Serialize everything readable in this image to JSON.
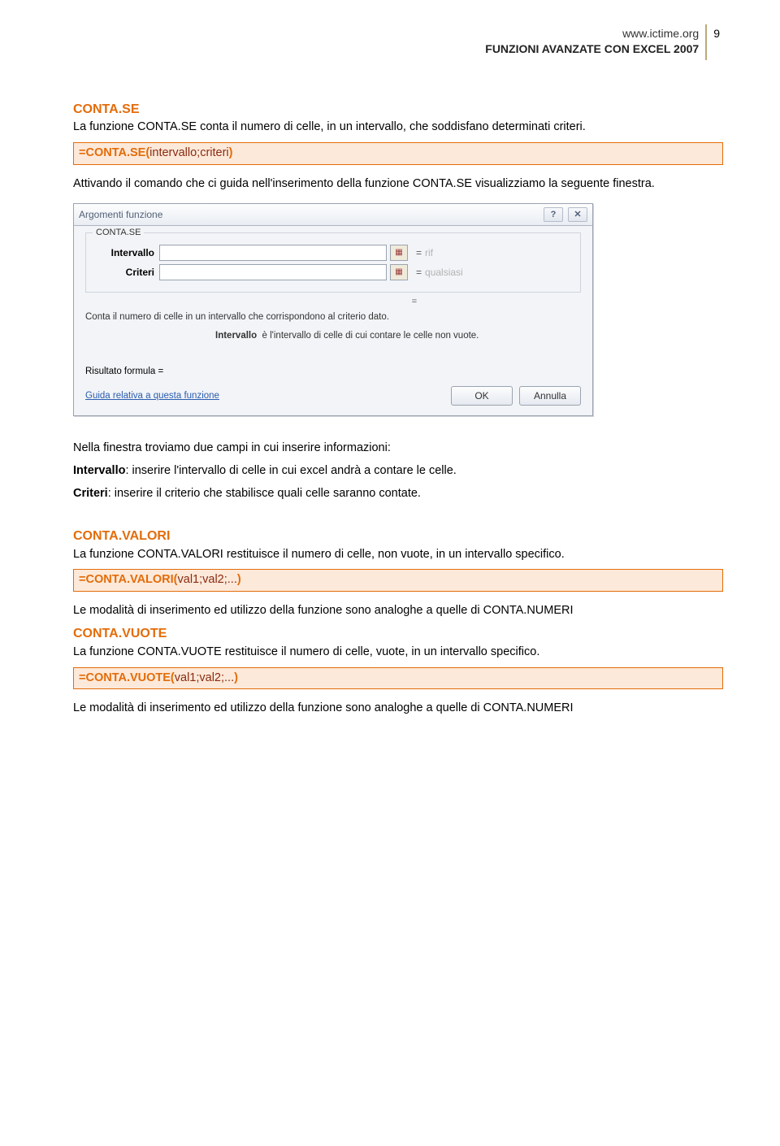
{
  "header": {
    "url": "www.ictime.org",
    "title": "FUNZIONI AVANZATE CON EXCEL 2007",
    "page": "9"
  },
  "sec1": {
    "title": "CONTA.SE",
    "intro": "La funzione CONTA.SE conta il numero di celle, in un intervallo, che soddisfano determinati criteri.",
    "formula_pre": "=CONTA.SE(",
    "formula_args": "intervallo;criteri",
    "formula_post": ")",
    "after_formula": "Attivando il comando che ci guida nell'inserimento della funzione CONTA.SE visualizziamo la seguente finestra.",
    "post_dialog_1": "Nella finestra troviamo due campi in cui inserire informazioni:",
    "post_dialog_2a": "Intervallo",
    "post_dialog_2b": ": inserire l'intervallo di celle in cui excel andrà a contare le celle.",
    "post_dialog_3a": "Criteri",
    "post_dialog_3b": ": inserire il criterio che stabilisce quali celle saranno contate."
  },
  "dialog": {
    "title": "Argomenti funzione",
    "legend": "CONTA.SE",
    "arg1_label": "Intervallo",
    "arg1_hint": "rif",
    "arg2_label": "Criteri",
    "arg2_hint": "qualsiasi",
    "eq": "=",
    "desc": "Conta il numero di celle in un intervallo che corrispondono al criterio dato.",
    "arg_desc_label": "Intervallo",
    "arg_desc_text": "è l'intervallo di celle di cui contare le celle non vuote.",
    "result_label": "Risultato formula =",
    "help": "Guida relativa a questa funzione",
    "ok": "OK",
    "cancel": "Annulla",
    "help_icon": "?",
    "close_icon": "✕"
  },
  "sec2": {
    "title": "CONTA.VALORI",
    "intro": "La funzione CONTA.VALORI restituisce il numero di celle, non vuote, in un intervallo specifico.",
    "formula_pre": "=CONTA.VALORI(",
    "formula_args": "val1;val2;...",
    "formula_post": ")",
    "after": "Le modalità di inserimento ed utilizzo della funzione sono analoghe a quelle di CONTA.NUMERI"
  },
  "sec3": {
    "title": "CONTA.VUOTE",
    "intro": "La funzione CONTA.VUOTE restituisce il numero di celle, vuote, in un intervallo specifico.",
    "formula_pre": "=CONTA.VUOTE(",
    "formula_args": "val1;val2;...",
    "formula_post": ")",
    "after": "Le modalità di inserimento ed utilizzo della funzione sono analoghe a quelle di CONTA.NUMERI"
  }
}
